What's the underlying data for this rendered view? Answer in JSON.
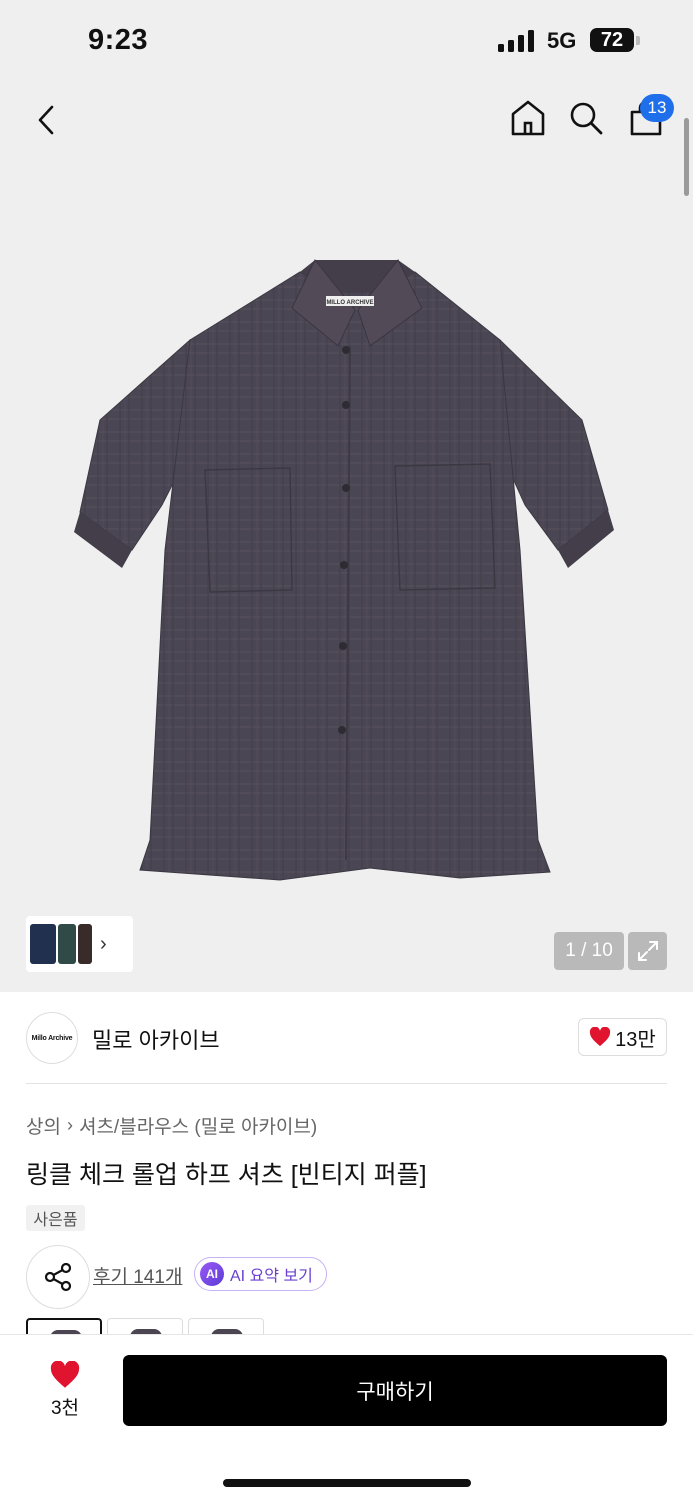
{
  "status": {
    "time": "9:23",
    "network": "5G",
    "battery": "72"
  },
  "header": {
    "cart_count": "13"
  },
  "gallery": {
    "page_indicator": "1 / 10",
    "thumbnail_colors": [
      "#22304f",
      "#2f4a47",
      "#3a2b2b"
    ],
    "shirt_logo_text": "MILLO ARCHIVE"
  },
  "brand": {
    "logo_text": "Millo Archive",
    "name": "밀로 아카이브",
    "likes": "13만"
  },
  "breadcrumb": {
    "category": "상의",
    "subcategory": "셔츠/블라우스 (밀로 아카이브)"
  },
  "product": {
    "title": "링클 체크 롤업 하프 셔츠 [빈티지 퍼플]",
    "gift_tag": "사은품"
  },
  "reviews": {
    "link": "후기 141개",
    "ai_badge": "AI",
    "ai_summary": "AI 요약 보기"
  },
  "bottom": {
    "wish_count": "3천",
    "buy_label": "구매하기"
  },
  "colors": {
    "accent_blue": "#1f6feb",
    "heart_red": "#e0142e",
    "ai_purple": "#6a3fd0",
    "shirt": "#4b4653"
  }
}
